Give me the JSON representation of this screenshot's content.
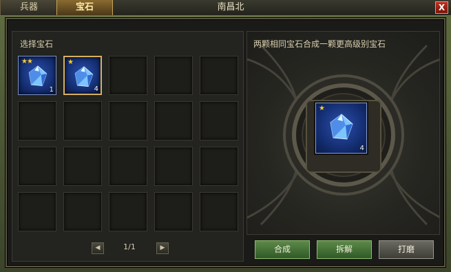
{
  "tabs": [
    {
      "label": "兵器",
      "active": false
    },
    {
      "label": "宝石",
      "active": true
    }
  ],
  "map_name": "南昌北",
  "close_label": "X",
  "left_panel": {
    "title": "选择宝石",
    "items": [
      {
        "stars": "★★",
        "count": "1",
        "icon": "blue-gem-icon"
      },
      {
        "stars": "★",
        "count": "4",
        "icon": "blue-gem-icon",
        "selected": true
      }
    ],
    "pager": {
      "prev_icon": "◀",
      "next_icon": "▶",
      "text": "1/1"
    }
  },
  "right_panel": {
    "hint": "两颗相同宝石合成一颗更高级别宝石",
    "slot": {
      "stars": "★",
      "count": "4",
      "icon": "blue-gem-icon"
    }
  },
  "buttons": {
    "combine": "合成",
    "dismantle": "拆解",
    "polish": "打磨"
  },
  "colors": {
    "star": "#ffcc30",
    "gem": "#2a4fae",
    "accent": "#c9a45a"
  }
}
